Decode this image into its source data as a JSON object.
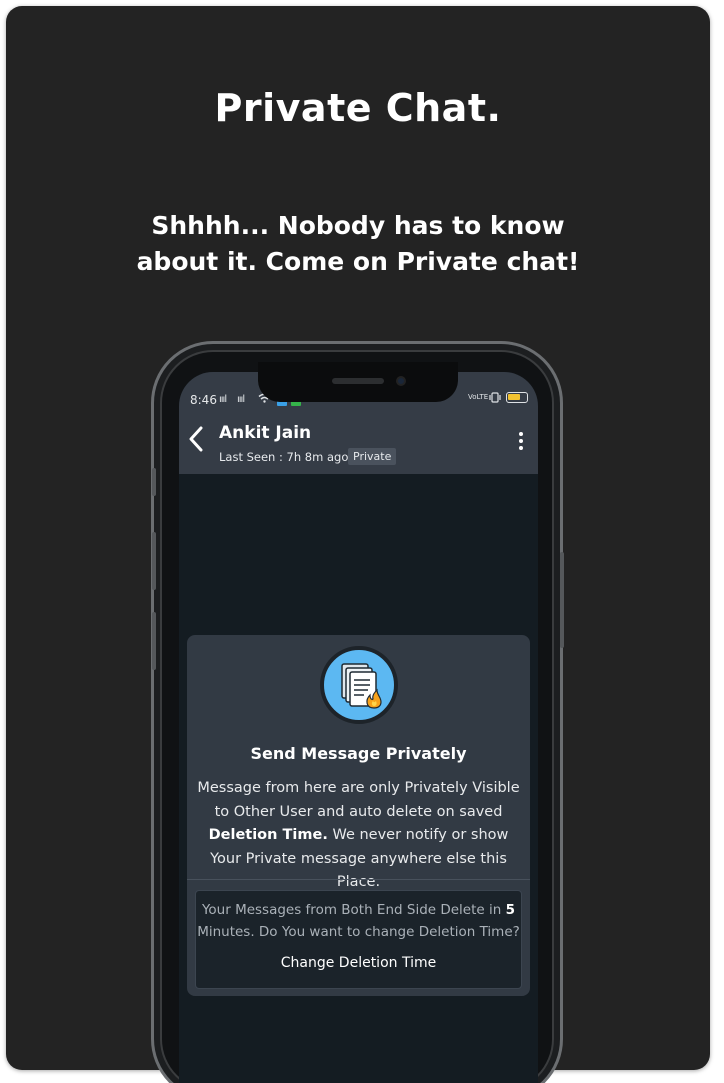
{
  "promo": {
    "headline": "Private Chat.",
    "subline_1": "Shhhh... Nobody has to know",
    "subline_2": "about it. Come on Private chat!"
  },
  "status_bar": {
    "time": "8:46",
    "signal_1": "ıııl",
    "signal_2": "ıııl",
    "network": "VoLTE",
    "battery_icon": "battery-icon",
    "vibrate_icon": "vibrate-icon"
  },
  "chat_header": {
    "contact_name": "Ankit Jain",
    "last_seen": "Last Seen : 7h 8m ago",
    "badge": "Private"
  },
  "private_info": {
    "icon": "document-fire-icon",
    "title": "Send Message Privately",
    "body_1": "Message from here are only Privately Visible to Other User and auto delete on saved",
    "body_bold": "Deletion Time.",
    "body_2": "We never notify or show Your Private message anywhere else this Place.",
    "deletion_text_1": "Your Messages from Both End Side Delete in",
    "deletion_minutes": "5",
    "deletion_text_2": "Minutes. Do You want to change Deletion Time?",
    "change_button": "Change Deletion Time"
  },
  "colors": {
    "background": "#232323",
    "app_bar": "#353c46",
    "accent_icon": "#5cb8f2",
    "battery": "#f2c230"
  }
}
